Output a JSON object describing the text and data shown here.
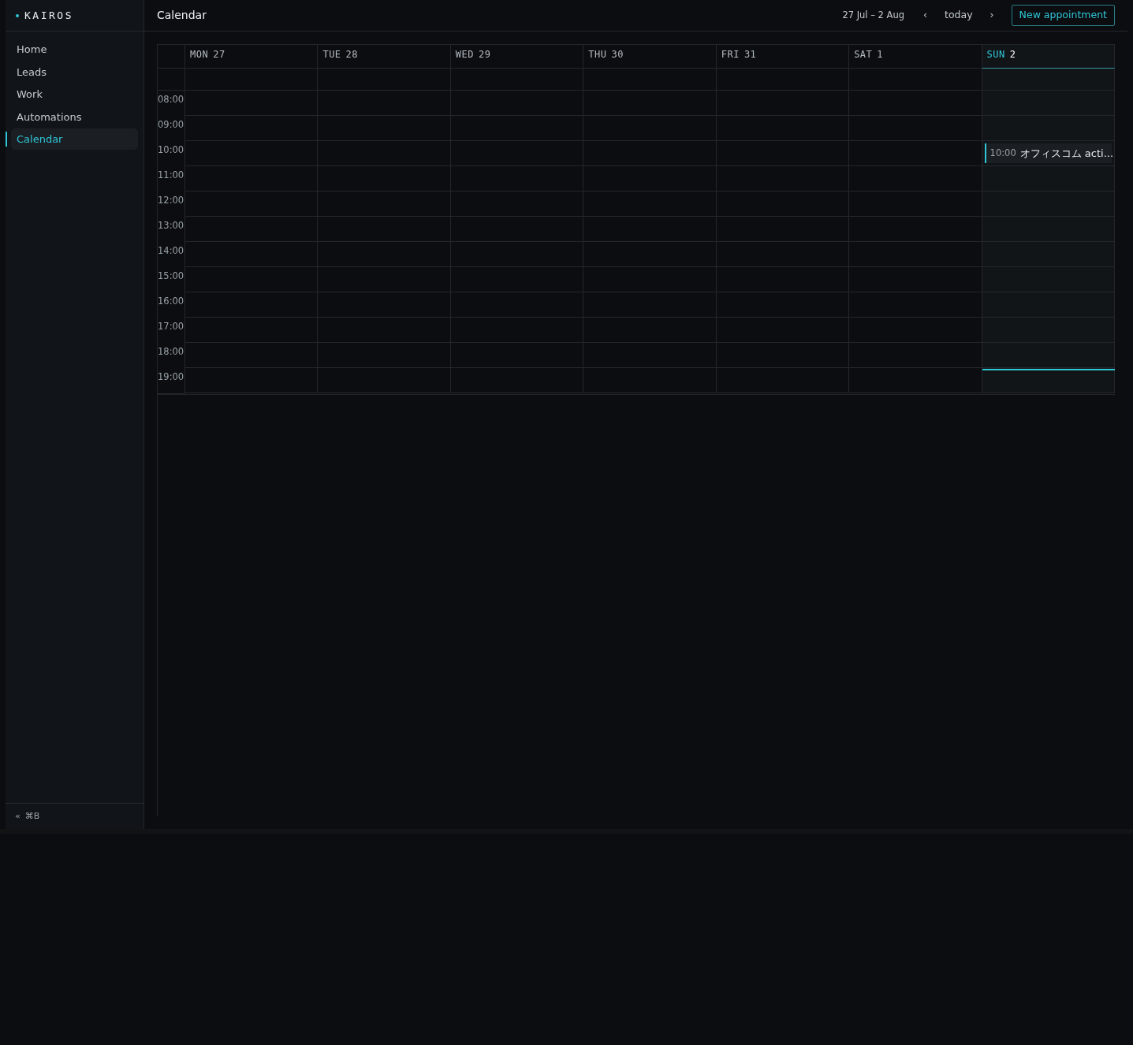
{
  "brand": {
    "name": "KAIROS"
  },
  "sidebar": {
    "items": [
      {
        "label": "Home",
        "selected": false
      },
      {
        "label": "Leads",
        "selected": false
      },
      {
        "label": "Work",
        "selected": false
      },
      {
        "label": "Automations",
        "selected": false
      },
      {
        "label": "Calendar",
        "selected": true
      }
    ],
    "footer": {
      "collapse": "«",
      "shortcut": "⌘B"
    }
  },
  "header": {
    "title": "Calendar",
    "range": "27 Jul – 2 Aug",
    "prev": "‹",
    "today": "today",
    "next": "›",
    "new_button": "New appointment"
  },
  "calendar": {
    "days": [
      {
        "weekday": "MON",
        "date": "27",
        "selected": false
      },
      {
        "weekday": "TUE",
        "date": "28",
        "selected": false
      },
      {
        "weekday": "WED",
        "date": "29",
        "selected": false
      },
      {
        "weekday": "THU",
        "date": "30",
        "selected": false
      },
      {
        "weekday": "FRI",
        "date": "31",
        "selected": false
      },
      {
        "weekday": "SAT",
        "date": "1",
        "selected": false
      },
      {
        "weekday": "SUN",
        "date": "2",
        "selected": true,
        "now_line": {
          "level": 0.92
        },
        "events": [
          {
            "time": "10:00",
            "title": "オフィスコム acti..."
          }
        ]
      }
    ],
    "hours": [
      "08:00",
      "09:00",
      "10:00",
      "11:00",
      "12:00",
      "13:00",
      "14:00",
      "15:00",
      "16:00",
      "17:00",
      "18:00",
      "19:00"
    ]
  }
}
